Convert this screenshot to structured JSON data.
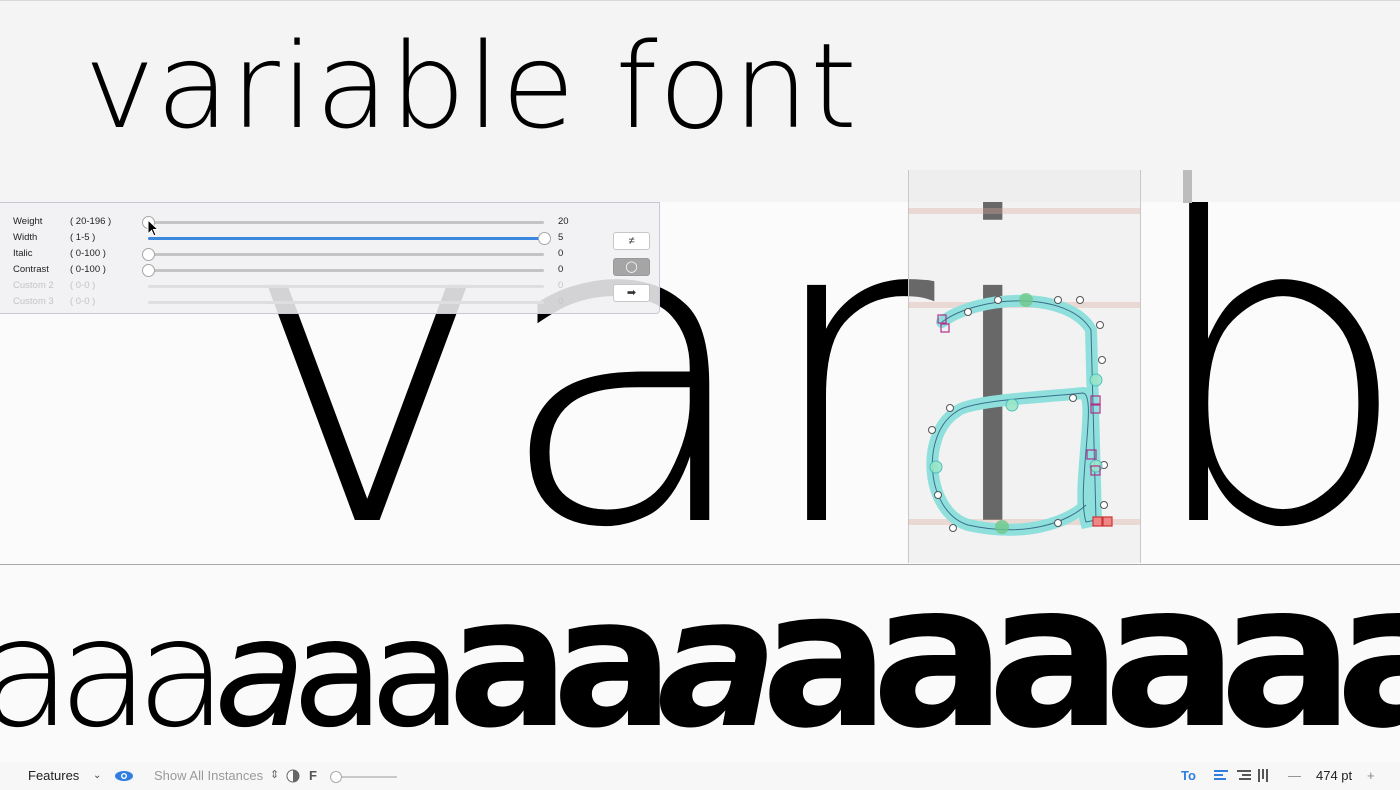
{
  "preview": {
    "title_text": "variable font",
    "large_text": "vari",
    "large_text_after": "b"
  },
  "glyph_editor": {
    "glyph": "a"
  },
  "waterfall": {
    "glyphs": [
      "a",
      "a",
      "a",
      "a",
      "a",
      "a",
      "a",
      "a",
      "a",
      "a",
      "a",
      "a",
      "a",
      "a",
      "a",
      "a",
      "a",
      "a",
      "a",
      "a",
      "a",
      "a"
    ]
  },
  "axes": [
    {
      "label": "Weight",
      "range": "( 20-196 )",
      "value": "20",
      "fraction": 0.0
    },
    {
      "label": "Width",
      "range": "( 1-5 )",
      "value": "5",
      "fraction": 1.0
    },
    {
      "label": "Italic",
      "range": "( 0-100 )",
      "value": "0",
      "fraction": 0.0
    },
    {
      "label": "Contrast",
      "range": "( 0-100 )",
      "value": "0",
      "fraction": 0.0
    },
    {
      "label": "Custom 2",
      "range": "( 0-0 )",
      "value": "0",
      "fraction": 0.0
    },
    {
      "label": "Custom 3",
      "range": "( 0-0 )",
      "value": "0",
      "fraction": 0.0
    }
  ],
  "panel_buttons": [
    {
      "glyph": "≠",
      "active": false
    },
    {
      "glyph": "◯",
      "active": true
    },
    {
      "glyph": "➡",
      "active": false
    }
  ],
  "statusbar": {
    "features_label": "Features",
    "show_instances_label": "Show All Instances",
    "f_label": "F",
    "size_label": "474 pt",
    "minus": "—",
    "plus": "+",
    "text_tool_label": "To"
  },
  "colors": {
    "accent": "#3a88df",
    "outline_fill": "#8fe0dc",
    "node_magenta": "#b0308a"
  }
}
